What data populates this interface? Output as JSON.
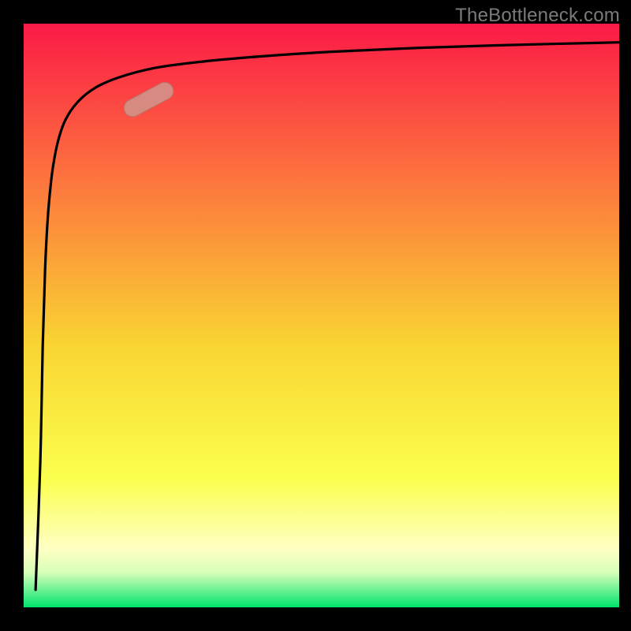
{
  "watermark": "TheBottleneck.com",
  "colors": {
    "bg_black": "#000000",
    "grad_top": "#fb1a46",
    "grad_mid1": "#fd6f3f",
    "grad_mid2": "#f9d432",
    "grad_mid3": "#fbff4e",
    "grad_low1": "#feffc3",
    "grad_low2": "#d8ffb8",
    "grad_bottom": "#00e36d",
    "curve": "#000000",
    "marker_fill": "#d29087",
    "marker_stroke": "#b97169"
  },
  "chart_data": {
    "type": "line",
    "title": "",
    "xlabel": "",
    "ylabel": "",
    "xlim": [
      0,
      100
    ],
    "ylim": [
      0,
      100
    ],
    "note": "axes unlabeled; values are percentage positions of the plotted bottleneck curve within the square area; y is measured upward from the green bottom toward the red top",
    "series": [
      {
        "name": "bottleneck-curve",
        "x": [
          2.0,
          2.8,
          3.2,
          3.6,
          4.0,
          4.5,
          5.0,
          5.8,
          7.0,
          9.0,
          12.0,
          16.0,
          22.0,
          30.0,
          40.0,
          52.0,
          65.0,
          80.0,
          100.0
        ],
        "values": [
          3.0,
          25.0,
          45.0,
          58.0,
          66.0,
          72.0,
          76.0,
          80.0,
          83.5,
          86.5,
          89.0,
          90.8,
          92.4,
          93.5,
          94.4,
          95.2,
          95.8,
          96.3,
          96.8
        ]
      }
    ],
    "marker": {
      "name": "highlight-segment",
      "x_center": 21.0,
      "y_center": 87.0,
      "angle_deg": 28.0,
      "length_pct": 9.0
    }
  }
}
